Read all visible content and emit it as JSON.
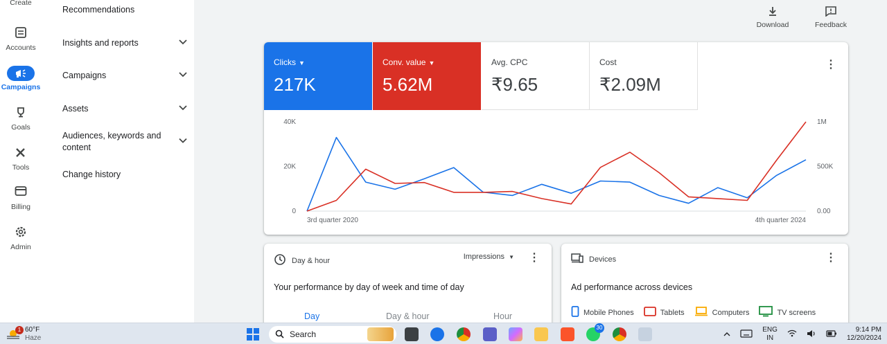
{
  "rail": {
    "items": [
      {
        "label": "Create",
        "icon": "plus-icon"
      },
      {
        "label": "Accounts",
        "icon": "accounts-icon"
      },
      {
        "label": "Campaigns",
        "icon": "megaphone-icon"
      },
      {
        "label": "Goals",
        "icon": "trophy-icon"
      },
      {
        "label": "Tools",
        "icon": "tools-icon"
      },
      {
        "label": "Billing",
        "icon": "credit-card-icon"
      },
      {
        "label": "Admin",
        "icon": "gear-icon"
      }
    ]
  },
  "subnav": {
    "items": [
      {
        "label": "Recommendations"
      },
      {
        "label": "Insights and reports"
      },
      {
        "label": "Campaigns"
      },
      {
        "label": "Assets"
      },
      {
        "label": "Audiences, keywords and content"
      },
      {
        "label": "Change history"
      }
    ]
  },
  "actions": {
    "download": "Download",
    "feedback": "Feedback"
  },
  "metrics": {
    "clicks": {
      "label": "Clicks",
      "value": "217K"
    },
    "conv_value": {
      "label": "Conv. value",
      "value": "5.62M"
    },
    "avg_cpc": {
      "label": "Avg. CPC",
      "value": "₹9.65"
    },
    "cost": {
      "label": "Cost",
      "value": "₹2.09M"
    }
  },
  "colors": {
    "blue": "#1a73e8",
    "red": "#d93025"
  },
  "chart_data": {
    "type": "line",
    "x_start_label": "3rd quarter 2020",
    "x_end_label": "4th quarter 2024",
    "left_ticks": [
      "0",
      "20K",
      "40K"
    ],
    "right_ticks": [
      "0.00",
      "500K",
      "1M"
    ],
    "ylim_left": [
      0,
      40000
    ],
    "ylim_right": [
      0,
      1000000
    ],
    "series": [
      {
        "name": "Clicks",
        "axis": "left",
        "color": "#1a73e8",
        "values": [
          0,
          33000,
          13000,
          9800,
          14500,
          19500,
          8500,
          7000,
          12000,
          8000,
          13500,
          13000,
          7000,
          3500,
          10500,
          6000,
          16000,
          23000
        ]
      },
      {
        "name": "Conv. value",
        "axis": "right",
        "color": "#d93025",
        "values": [
          0,
          120000,
          470000,
          310000,
          320000,
          210000,
          210000,
          220000,
          140000,
          80000,
          490000,
          660000,
          430000,
          160000,
          140000,
          120000,
          570000,
          1000000
        ]
      }
    ]
  },
  "day_hour_card": {
    "heading": "Day & hour",
    "selector": "Impressions",
    "title": "Your performance by day of week and time of day",
    "tabs": [
      "Day",
      "Day & hour",
      "Hour"
    ]
  },
  "devices_card": {
    "heading": "Devices",
    "title": "Ad performance across devices",
    "legend": [
      {
        "label": "Mobile Phones",
        "color": "#1a73e8"
      },
      {
        "label": "Tablets",
        "color": "#d93025"
      },
      {
        "label": "Computers",
        "color": "#f9ab00"
      },
      {
        "label": "TV screens",
        "color": "#1e8e3e"
      }
    ]
  },
  "taskbar": {
    "weather_temp": "60°F",
    "weather_desc": "Haze",
    "weather_badge": "1",
    "search_label": "Search",
    "whatsapp_badge": "30",
    "lang_top": "ENG",
    "lang_bottom": "IN",
    "time": "9:14 PM",
    "date": "12/20/2024"
  }
}
